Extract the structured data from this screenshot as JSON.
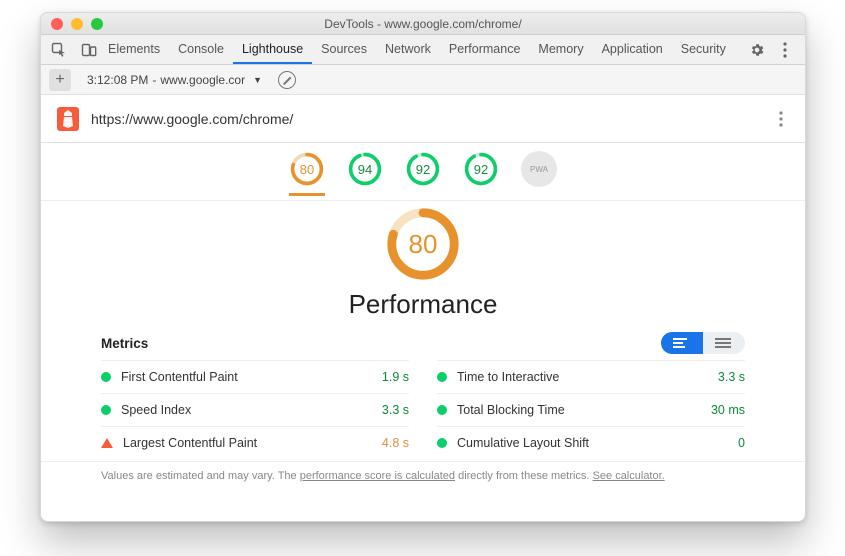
{
  "window": {
    "title": "DevTools - www.google.com/chrome/"
  },
  "tabs": {
    "items": [
      "Elements",
      "Console",
      "Lighthouse",
      "Sources",
      "Network",
      "Performance",
      "Memory",
      "Application",
      "Security"
    ],
    "active": "Lighthouse"
  },
  "context": {
    "timestamp": "3:12:08 PM",
    "host": "www.google.cor",
    "caret": "▼"
  },
  "lighthouse": {
    "url": "https://www.google.com/chrome/",
    "dials": [
      {
        "score": 80,
        "color": "orange",
        "active": true
      },
      {
        "score": 94,
        "color": "green"
      },
      {
        "score": 92,
        "color": "green"
      },
      {
        "score": 92,
        "color": "green"
      },
      {
        "label": "PWA",
        "color": "grey"
      }
    ],
    "category": {
      "score": 80,
      "title": "Performance"
    },
    "metrics_label": "Metrics",
    "metrics": {
      "left": [
        {
          "name": "First Contentful Paint",
          "value": "1.9 s",
          "status": "good",
          "vclass": "val-green"
        },
        {
          "name": "Speed Index",
          "value": "3.3 s",
          "status": "good",
          "vclass": "val-green"
        },
        {
          "name": "Largest Contentful Paint",
          "value": "4.8 s",
          "status": "warn",
          "vclass": "val-orange"
        }
      ],
      "right": [
        {
          "name": "Time to Interactive",
          "value": "3.3 s",
          "status": "good",
          "vclass": "val-green"
        },
        {
          "name": "Total Blocking Time",
          "value": "30 ms",
          "status": "good",
          "vclass": "val-green"
        },
        {
          "name": "Cumulative Layout Shift",
          "value": "0",
          "status": "good",
          "vclass": "val-green"
        }
      ]
    },
    "footnote": {
      "pre": "Values are estimated and may vary. The ",
      "link1": "performance score is calculated",
      "mid": " directly from these metrics. ",
      "link2": "See calculator."
    }
  }
}
